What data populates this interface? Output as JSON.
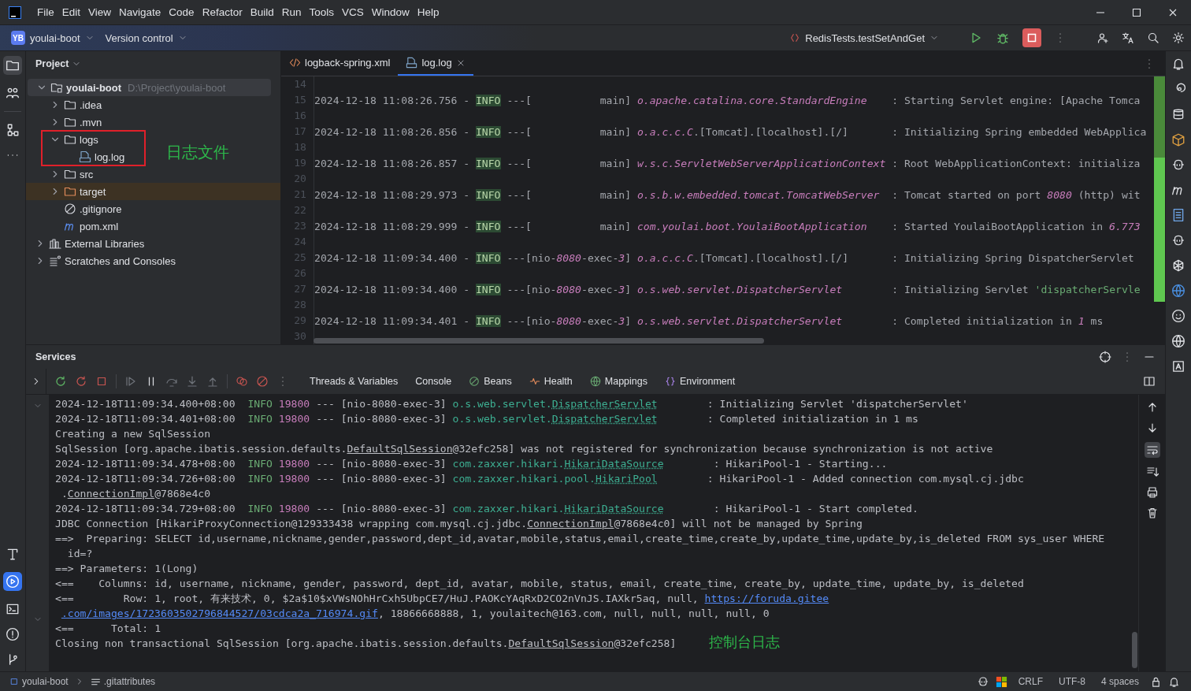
{
  "menu": [
    {
      "label": "File"
    },
    {
      "label": "Edit"
    },
    {
      "label": "View"
    },
    {
      "label": "Navigate"
    },
    {
      "label": "Code"
    },
    {
      "label": "Refactor"
    },
    {
      "label": "Build"
    },
    {
      "label": "Run"
    },
    {
      "label": "Tools"
    },
    {
      "label": "VCS"
    },
    {
      "label": "Window"
    },
    {
      "label": "Help"
    }
  ],
  "toolbar": {
    "project_badge": "YB",
    "project": "youlai-boot",
    "vcs": "Version control",
    "run_config": "RedisTests.testSetAndGet"
  },
  "project_panel": {
    "title": "Project",
    "note": "日志文件",
    "tree": [
      {
        "label": "youlai-boot",
        "path": "D:\\Project\\youlai-boot",
        "kind": "project",
        "expanded": true,
        "selected": true,
        "children": [
          {
            "label": ".idea",
            "kind": "folder",
            "expanded": false,
            "selected": false
          },
          {
            "label": ".mvn",
            "kind": "folder",
            "expanded": false,
            "selected": false
          },
          {
            "label": "logs",
            "kind": "folder",
            "expanded": true,
            "selected": false,
            "children": [
              {
                "label": "log.log",
                "kind": "log-file",
                "selected": false
              }
            ]
          },
          {
            "label": "src",
            "kind": "folder",
            "expanded": false,
            "selected": false
          },
          {
            "label": "target",
            "kind": "excluded-folder",
            "expanded": false,
            "selected": false
          },
          {
            "label": ".gitignore",
            "kind": "ignore-file",
            "selected": false
          },
          {
            "label": "pom.xml",
            "kind": "maven-file",
            "selected": false
          }
        ]
      },
      {
        "label": "External Libraries",
        "kind": "libraries",
        "expanded": false,
        "selected": false
      },
      {
        "label": "Scratches and Consoles",
        "kind": "scratches",
        "expanded": false,
        "selected": false
      }
    ]
  },
  "editor": {
    "tabs": [
      {
        "label": "logback-spring.xml",
        "kind": "xml",
        "selected": false
      },
      {
        "label": "log.log",
        "kind": "log",
        "selected": true
      }
    ],
    "lines": [
      {
        "number": "14"
      },
      {
        "number": "15",
        "segments": [
          {
            "text": "2024-12-18 11:08:26.756 - ",
            "kind": "plain"
          },
          {
            "text": "INFO",
            "kind": "level"
          },
          {
            "text": " ---[           main] ",
            "kind": "plain"
          },
          {
            "text": "o.apache.catalina.core.StandardEngine",
            "kind": "em"
          },
          {
            "text": "    : Starting Servlet engine: [Apache Tomca",
            "kind": "plain"
          }
        ]
      },
      {
        "number": "16"
      },
      {
        "number": "17",
        "segments": [
          {
            "text": "2024-12-18 11:08:26.856 - ",
            "kind": "plain"
          },
          {
            "text": "INFO",
            "kind": "level"
          },
          {
            "text": " ---[           main] ",
            "kind": "plain"
          },
          {
            "text": "o.a.c.c.C",
            "kind": "em"
          },
          {
            "text": ".[Tomcat].[localhost].[/]       : Initializing Spring embedded WebApplica",
            "kind": "plain"
          }
        ]
      },
      {
        "number": "18"
      },
      {
        "number": "19",
        "segments": [
          {
            "text": "2024-12-18 11:08:26.857 - ",
            "kind": "plain"
          },
          {
            "text": "INFO",
            "kind": "level"
          },
          {
            "text": " ---[           main] ",
            "kind": "plain"
          },
          {
            "text": "w.s.c.ServletWebServerApplicationContext",
            "kind": "em"
          },
          {
            "text": " : Root WebApplicationContext: initializa",
            "kind": "plain"
          }
        ]
      },
      {
        "number": "20"
      },
      {
        "number": "21",
        "segments": [
          {
            "text": "2024-12-18 11:08:29.973 - ",
            "kind": "plain"
          },
          {
            "text": "INFO",
            "kind": "level"
          },
          {
            "text": " ---[           main] ",
            "kind": "plain"
          },
          {
            "text": "o.s.b.w.embedded.tomcat.TomcatWebServer",
            "kind": "em"
          },
          {
            "text": "  : Tomcat started on port ",
            "kind": "plain"
          },
          {
            "text": "8080",
            "kind": "em"
          },
          {
            "text": " (http) wit",
            "kind": "plain"
          }
        ]
      },
      {
        "number": "22"
      },
      {
        "number": "23",
        "segments": [
          {
            "text": "2024-12-18 11:08:29.999 - ",
            "kind": "plain"
          },
          {
            "text": "INFO",
            "kind": "level"
          },
          {
            "text": " ---[           main] ",
            "kind": "plain"
          },
          {
            "text": "com.youlai.boot.YoulaiBootApplication",
            "kind": "em"
          },
          {
            "text": "    : Started YoulaiBootApplication in ",
            "kind": "plain"
          },
          {
            "text": "6.773",
            "kind": "em"
          }
        ]
      },
      {
        "number": "24"
      },
      {
        "number": "25",
        "segments": [
          {
            "text": "2024-12-18 11:09:34.400 - ",
            "kind": "plain"
          },
          {
            "text": "INFO",
            "kind": "level"
          },
          {
            "text": " ---[nio-",
            "kind": "plain"
          },
          {
            "text": "8080",
            "kind": "em"
          },
          {
            "text": "-exec-",
            "kind": "plain"
          },
          {
            "text": "3",
            "kind": "em"
          },
          {
            "text": "] ",
            "kind": "plain"
          },
          {
            "text": "o.a.c.c.C",
            "kind": "em"
          },
          {
            "text": ".[Tomcat].[localhost].[/]       : Initializing Spring DispatcherServlet",
            "kind": "plain"
          }
        ]
      },
      {
        "number": "26"
      },
      {
        "number": "27",
        "segments": [
          {
            "text": "2024-12-18 11:09:34.400 - ",
            "kind": "plain"
          },
          {
            "text": "INFO",
            "kind": "level"
          },
          {
            "text": " ---[nio-",
            "kind": "plain"
          },
          {
            "text": "8080",
            "kind": "em"
          },
          {
            "text": "-exec-",
            "kind": "plain"
          },
          {
            "text": "3",
            "kind": "em"
          },
          {
            "text": "] ",
            "kind": "plain"
          },
          {
            "text": "o.s.web.servlet.DispatcherServlet",
            "kind": "em"
          },
          {
            "text": "        : Initializing Servlet ",
            "kind": "plain"
          },
          {
            "text": "'dispatcherServle",
            "kind": "string"
          }
        ]
      },
      {
        "number": "28"
      },
      {
        "number": "29",
        "segments": [
          {
            "text": "2024-12-18 11:09:34.401 - ",
            "kind": "plain"
          },
          {
            "text": "INFO",
            "kind": "level"
          },
          {
            "text": " ---[nio-",
            "kind": "plain"
          },
          {
            "text": "8080",
            "kind": "em"
          },
          {
            "text": "-exec-",
            "kind": "plain"
          },
          {
            "text": "3",
            "kind": "em"
          },
          {
            "text": "] ",
            "kind": "plain"
          },
          {
            "text": "o.s.web.servlet.DispatcherServlet",
            "kind": "em"
          },
          {
            "text": "        : Completed initialization in ",
            "kind": "plain"
          },
          {
            "text": "1",
            "kind": "em"
          },
          {
            "text": " ms",
            "kind": "plain"
          }
        ]
      },
      {
        "number": "30"
      }
    ]
  },
  "services": {
    "title": "Services",
    "note": "控制台日志",
    "tabs": [
      {
        "label": "Threads & Variables",
        "kind": "plain"
      },
      {
        "label": "Console",
        "kind": "plain"
      },
      {
        "label": "Beans",
        "kind": "beans"
      },
      {
        "label": "Health",
        "kind": "health"
      },
      {
        "label": "Mappings",
        "kind": "mappings"
      },
      {
        "label": "Environment",
        "kind": "environment"
      }
    ],
    "console": [
      {
        "wrapped": false,
        "segments": [
          {
            "text": "2024-12-18T11:09:34.400+08:00  ",
            "kind": "plain"
          },
          {
            "text": "INFO",
            "kind": "level"
          },
          {
            "text": " 19800",
            "kind": "pid"
          },
          {
            "text": " --- [nio-8080-exec-3] ",
            "kind": "plain"
          },
          {
            "text": "o.s.web.servlet.",
            "kind": "logger"
          },
          {
            "text": "DispatcherServlet",
            "kind": "logger-ref"
          },
          {
            "text": "        : Initializing Servlet 'dispatcherServlet'",
            "kind": "plain"
          }
        ]
      },
      {
        "wrapped": false,
        "segments": [
          {
            "text": "2024-12-18T11:09:34.401+08:00  ",
            "kind": "plain"
          },
          {
            "text": "INFO",
            "kind": "level"
          },
          {
            "text": " 19800",
            "kind": "pid"
          },
          {
            "text": " --- [nio-8080-exec-3] ",
            "kind": "plain"
          },
          {
            "text": "o.s.web.servlet.",
            "kind": "logger"
          },
          {
            "text": "DispatcherServlet",
            "kind": "logger-ref"
          },
          {
            "text": "        : Completed initialization in 1 ms",
            "kind": "plain"
          }
        ]
      },
      {
        "wrapped": false,
        "segments": [
          {
            "text": "Creating a new SqlSession",
            "kind": "plain"
          }
        ]
      },
      {
        "wrapped": false,
        "segments": [
          {
            "text": "SqlSession [org.apache.ibatis.session.defaults.",
            "kind": "plain"
          },
          {
            "text": "DefaultSqlSession",
            "kind": "ref"
          },
          {
            "text": "@32efc258] was not registered for synchronization because synchronization is not active",
            "kind": "plain"
          }
        ]
      },
      {
        "wrapped": false,
        "segments": [
          {
            "text": "2024-12-18T11:09:34.478+08:00  ",
            "kind": "plain"
          },
          {
            "text": "INFO",
            "kind": "level"
          },
          {
            "text": " 19800",
            "kind": "pid"
          },
          {
            "text": " --- [nio-8080-exec-3] ",
            "kind": "plain"
          },
          {
            "text": "com.zaxxer.hikari.",
            "kind": "logger"
          },
          {
            "text": "HikariDataSource",
            "kind": "logger-ref"
          },
          {
            "text": "        : HikariPool-1 - Starting...",
            "kind": "plain"
          }
        ]
      },
      {
        "wrapped": false,
        "segments": [
          {
            "text": "2024-12-18T11:09:34.726+08:00  ",
            "kind": "plain"
          },
          {
            "text": "INFO",
            "kind": "level"
          },
          {
            "text": " 19800",
            "kind": "pid"
          },
          {
            "text": " --- [nio-8080-exec-3] ",
            "kind": "plain"
          },
          {
            "text": "com.zaxxer.hikari.pool.",
            "kind": "logger"
          },
          {
            "text": "HikariPool",
            "kind": "logger-ref"
          },
          {
            "text": "        : HikariPool-1 - Added connection com.mysql.cj.jdbc",
            "kind": "plain"
          }
        ]
      },
      {
        "wrapped": true,
        "segments": [
          {
            "text": ".",
            "kind": "plain"
          },
          {
            "text": "ConnectionImpl",
            "kind": "ref"
          },
          {
            "text": "@7868e4c0",
            "kind": "plain"
          }
        ]
      },
      {
        "wrapped": false,
        "segments": [
          {
            "text": "2024-12-18T11:09:34.729+08:00  ",
            "kind": "plain"
          },
          {
            "text": "INFO",
            "kind": "level"
          },
          {
            "text": " 19800",
            "kind": "pid"
          },
          {
            "text": " --- [nio-8080-exec-3] ",
            "kind": "plain"
          },
          {
            "text": "com.zaxxer.hikari.",
            "kind": "logger"
          },
          {
            "text": "HikariDataSource",
            "kind": "logger-ref"
          },
          {
            "text": "        : HikariPool-1 - Start completed.",
            "kind": "plain"
          }
        ]
      },
      {
        "wrapped": false,
        "segments": [
          {
            "text": "JDBC Connection [HikariProxyConnection@129333438 wrapping com.mysql.cj.jdbc.",
            "kind": "plain"
          },
          {
            "text": "ConnectionImpl",
            "kind": "ref"
          },
          {
            "text": "@7868e4c0] will not be managed by Spring",
            "kind": "plain"
          }
        ]
      },
      {
        "wrapped": false,
        "segments": [
          {
            "text": "==>  Preparing: SELECT id,username,nickname,gender,password,dept_id,avatar,mobile,status,email,create_time,create_by,update_time,update_by,is_deleted FROM sys_user WHERE",
            "kind": "plain"
          }
        ]
      },
      {
        "wrapped": false,
        "segments": [
          {
            "text": "  id=?",
            "kind": "plain"
          }
        ]
      },
      {
        "wrapped": false,
        "segments": [
          {
            "text": "==> Parameters: 1(Long)",
            "kind": "plain"
          }
        ]
      },
      {
        "wrapped": false,
        "segments": [
          {
            "text": "<==    Columns: id, username, nickname, gender, password, dept_id, avatar, mobile, status, email, create_time, create_by, update_time, update_by, is_deleted",
            "kind": "plain"
          }
        ]
      },
      {
        "wrapped": false,
        "segments": [
          {
            "text": "<==        Row: 1, root, 有来技术, 0, $2a$10$xVWsNOhHrCxh5UbpCE7/HuJ.PAOKcYAqRxD2CO2nVnJS.IAXkr5aq, null, ",
            "kind": "plain"
          },
          {
            "text": "https://foruda.gitee",
            "kind": "link"
          }
        ]
      },
      {
        "wrapped": true,
        "segments": [
          {
            "text": ".com/images/1723603502796844527/03cdca2a_716974.gif",
            "kind": "link"
          },
          {
            "text": ", 18866668888, 1, youlaitech@163.com, null, null, null, null, 0",
            "kind": "plain"
          }
        ]
      },
      {
        "wrapped": false,
        "segments": [
          {
            "text": "<==      Total: 1",
            "kind": "plain"
          }
        ]
      },
      {
        "wrapped": false,
        "segments": [
          {
            "text": "Closing non transactional SqlSession [org.apache.ibatis.session.defaults.",
            "kind": "plain"
          },
          {
            "text": "DefaultSqlSession",
            "kind": "ref"
          },
          {
            "text": "@32efc258]",
            "kind": "plain"
          }
        ]
      }
    ]
  },
  "status_bar": {
    "project": "youlai-boot",
    "file": ".gitattributes",
    "line_separator": "CRLF",
    "encoding": "UTF-8",
    "indent": "4 spaces"
  }
}
